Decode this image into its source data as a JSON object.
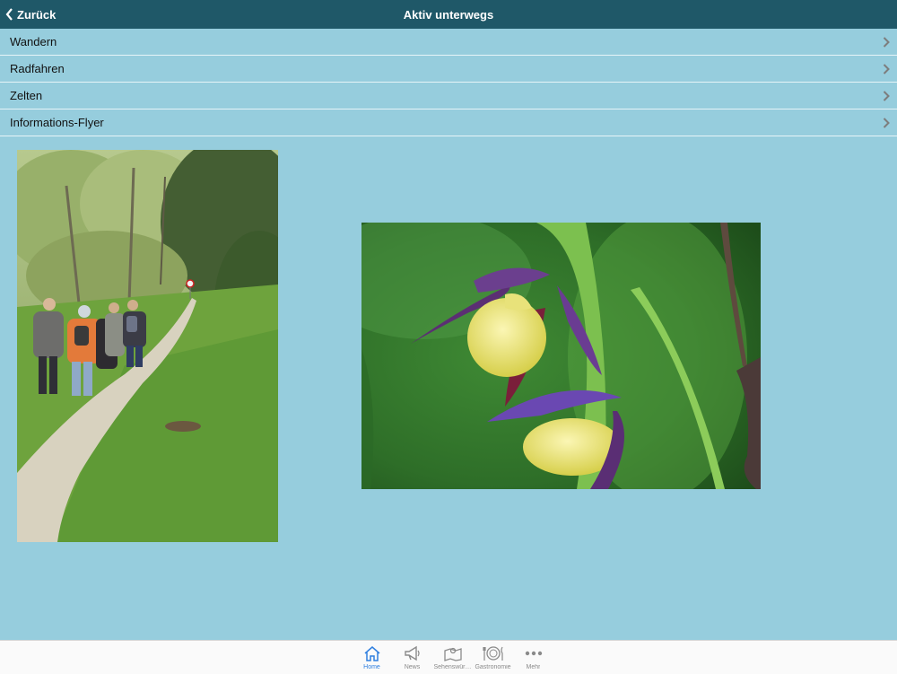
{
  "navbar": {
    "back_label": "Zurück",
    "title": "Aktiv unterwegs"
  },
  "menu": {
    "items": [
      {
        "label": "Wandern"
      },
      {
        "label": "Radfahren"
      },
      {
        "label": "Zelten"
      },
      {
        "label": "Informations-Flyer"
      }
    ],
    "chevron_icon": "chevron-right-icon"
  },
  "images": [
    {
      "subject": "hikers-on-forest-path"
    },
    {
      "subject": "ladys-slipper-orchid"
    }
  ],
  "tabbar": {
    "tabs": [
      {
        "label": "Home",
        "icon": "home-icon",
        "active": true
      },
      {
        "label": "News",
        "icon": "megaphone-icon"
      },
      {
        "label": "Sehenswür…",
        "icon": "map-icon"
      },
      {
        "label": "Gastronomie",
        "icon": "plate-cutlery-icon"
      },
      {
        "label": "Mehr",
        "icon": "more-dots-icon"
      }
    ]
  },
  "colors": {
    "navbar": "#1f5868",
    "background": "#96cddd",
    "accent": "#2f7fe0"
  }
}
